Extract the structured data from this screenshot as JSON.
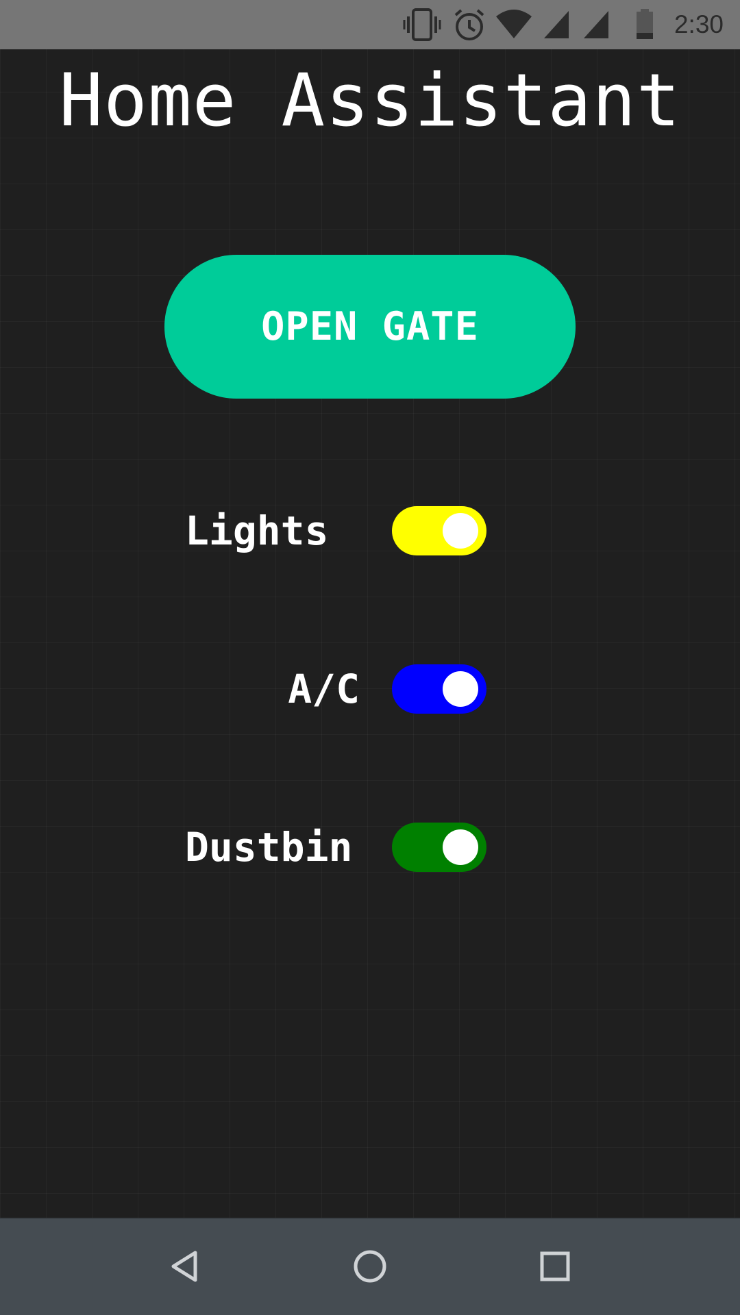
{
  "status_bar": {
    "time": "2:30",
    "icons": [
      "vibrate-icon",
      "alarm-icon",
      "wifi-icon",
      "signal-icon",
      "signal-icon",
      "battery-icon"
    ]
  },
  "title": "Home Assistant",
  "gate_button": {
    "label": "OPEN GATE",
    "color": "#00cc99"
  },
  "controls": [
    {
      "label": "Lights",
      "state": "on",
      "color": "#ffff00"
    },
    {
      "label": "A/C",
      "state": "on",
      "color": "#0000ff"
    },
    {
      "label": "Dustbin",
      "state": "on",
      "color": "#008000"
    }
  ],
  "nav_bar": {
    "buttons": [
      "back-icon",
      "home-icon",
      "recents-icon"
    ]
  }
}
